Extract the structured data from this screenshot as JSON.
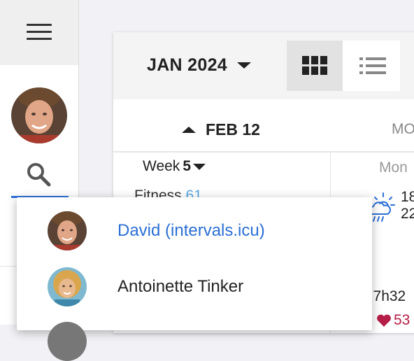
{
  "calendar": {
    "month_label": "JAN 2024",
    "prev_label": "FEB 12",
    "day_header": "MO",
    "week_text": "Week",
    "week_number": "5",
    "fitness_label": "Fitness",
    "fitness_value": "61",
    "day_name": "Mon",
    "temp_high": "18",
    "temp_low": "22",
    "duration": "0 7h32",
    "heart_value": "53"
  },
  "account_menu": {
    "items": [
      {
        "name": "David (intervals.icu)",
        "selected": true
      },
      {
        "name": "Antoinette Tinker",
        "selected": false
      }
    ]
  },
  "colors": {
    "accent": "#2b6fd6",
    "fitness": "#5aa7e0",
    "heart": "#b51e46"
  },
  "icons": [
    "menu-icon",
    "search-icon",
    "grid-view-icon",
    "list-view-icon",
    "weather-icon",
    "heart-icon"
  ]
}
